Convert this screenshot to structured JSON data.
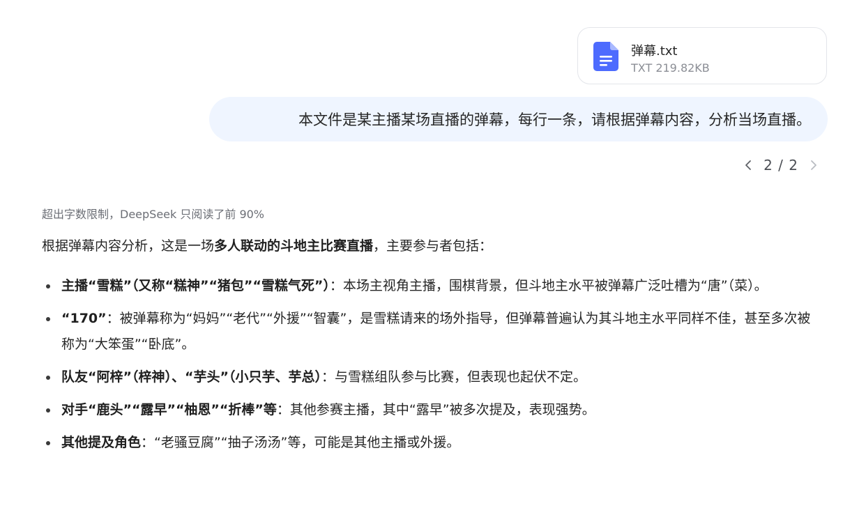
{
  "attachment": {
    "name": "弹幕.txt",
    "meta": "TXT 219.82KB",
    "icon": "document-icon",
    "icon_color": "#4d6bfe"
  },
  "user_message": "本文件是某主播某场直播的弹幕，每行一条，请根据弹幕内容，分析当场直播。",
  "pager": {
    "text": "2 / 2",
    "prev_icon": "chevron-left-icon",
    "next_icon": "chevron-right-icon"
  },
  "response": {
    "notice": "超出字数限制，DeepSeek 只阅读了前 90%",
    "intro_prefix": "根据弹幕内容分析，这是一场",
    "intro_bold": "多人联动的斗地主比赛直播",
    "intro_suffix": "，主要参与者包括：",
    "bullets": [
      {
        "bold": "主播“雪糕”（又称“糕神”“猪包”“雪糕气死”）",
        "text": "：本场主视角主播，围棋背景，但斗地主水平被弹幕广泛吐槽为“唐”（菜）。"
      },
      {
        "bold": "“170”",
        "text": "：被弹幕称为“妈妈”“老代”“外援”“智囊”，是雪糕请来的场外指导，但弹幕普遍认为其斗地主水平同样不佳，甚至多次被称为“大笨蛋”“卧底”。"
      },
      {
        "bold": "队友“阿梓”（梓神）、“芋头”（小只芋、芋总）",
        "text": "：与雪糕组队参与比赛，但表现也起伏不定。"
      },
      {
        "bold": "对手“鹿头”“露早”“柚恩”“折棒”等",
        "text": "：其他参赛主播，其中“露早”被多次提及，表现强势。"
      },
      {
        "bold": "其他提及角色",
        "text": "：“老骚豆腐”“抽子汤汤”等，可能是其他主播或外援。"
      }
    ]
  }
}
